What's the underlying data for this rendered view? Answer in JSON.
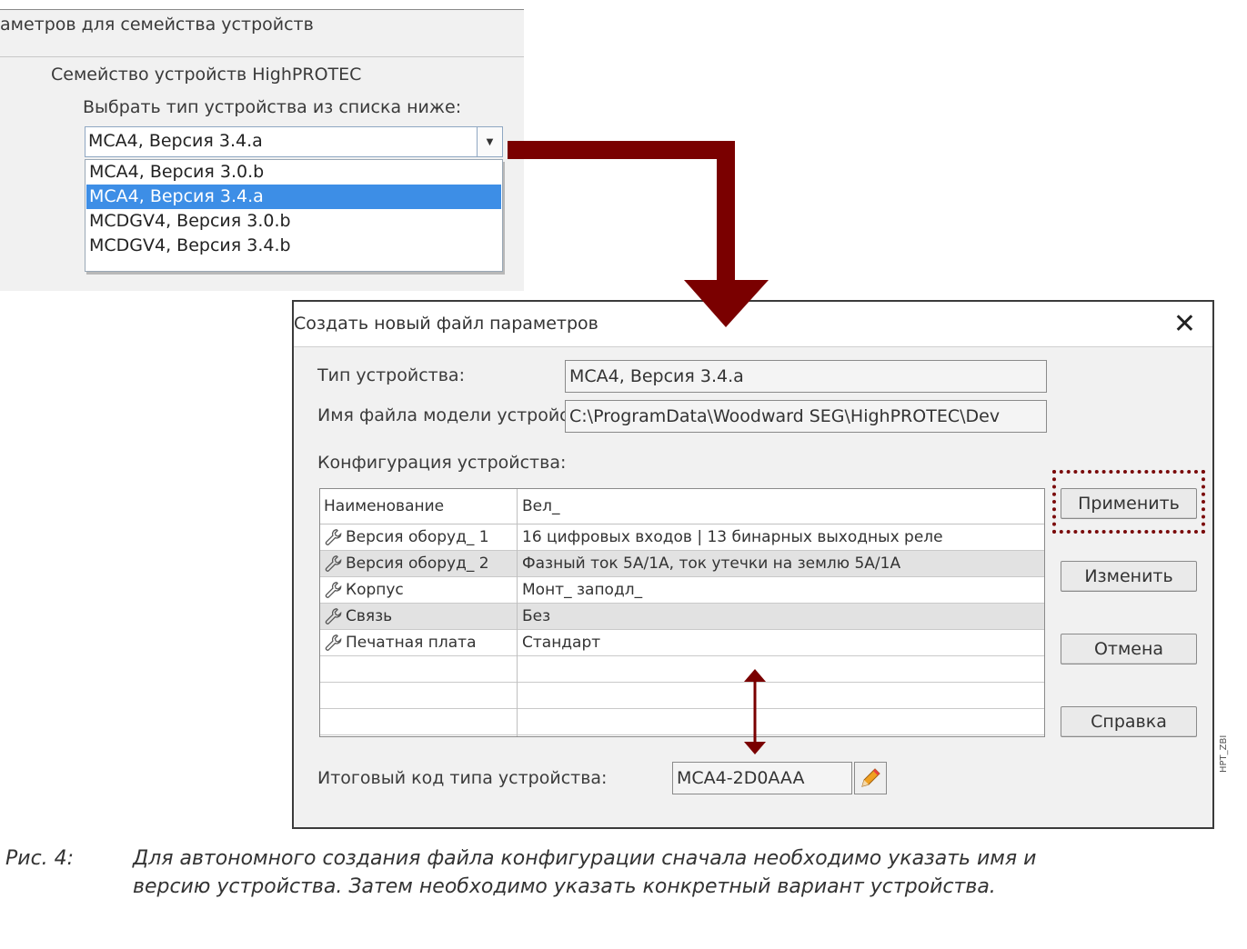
{
  "family_panel": {
    "header": "аметров для семейства устройств",
    "family_name": "Семейство устройств HighPROTEC",
    "select_prompt": "Выбрать тип устройства из списка ниже:",
    "combo_value": "MCA4, Версия 3.4.a",
    "options": [
      {
        "label": "MCA4, Версия 3.0.b",
        "selected": false
      },
      {
        "label": "MCA4, Версия 3.4.a",
        "selected": true
      },
      {
        "label": "MCDGV4, Версия 3.0.b",
        "selected": false
      },
      {
        "label": "MCDGV4, Версия 3.4.b",
        "selected": false
      }
    ]
  },
  "dialog": {
    "title": "Создать новый файл параметров",
    "close_glyph": "✕",
    "device_type_label": "Тип устройства:",
    "device_type_value": "MCA4, Версия 3.4.a",
    "model_file_label": "Имя файла модели устройства:",
    "model_file_value": "C:\\ProgramData\\Woodward SEG\\HighPROTEC\\Dev",
    "config_label": "Конфигурация устройства:",
    "table": {
      "headers": [
        "Наименование",
        "Вел_"
      ],
      "rows": [
        {
          "name": "Версия оборуд_ 1",
          "value": "16 цифровых входов | 13 бинарных выходных реле"
        },
        {
          "name": "Версия оборуд_ 2",
          "value": "Фазный ток 5А/1А, ток утечки на землю 5А/1А"
        },
        {
          "name": "Корпус",
          "value": "Монт_ заподл_"
        },
        {
          "name": "Связь",
          "value": "Без"
        },
        {
          "name": "Печатная плата",
          "value": "Стандарт"
        }
      ]
    },
    "buttons": {
      "apply": "Применить",
      "change": "Изменить",
      "cancel": "Отмена",
      "help": "Справка"
    },
    "type_code_label": "Итоговый код типа устройства:",
    "type_code_value": "MCA4-2D0AAA"
  },
  "side_label": "HPT_ZBI",
  "caption": {
    "number": "Рис. 4:",
    "line1": "Для автономного создания файла конфигурации сначала необходимо указать имя и",
    "line2": "версию устройства. Затем необходимо указать конкретный вариант устройства."
  },
  "colors": {
    "arrow": "#7a0000",
    "selection": "#3d8ee6",
    "highlight_border": "#7a0b0b"
  },
  "icons": [
    "chevron-down-icon",
    "close-icon",
    "wrench-icon",
    "pencil-icon",
    "double-arrow-icon"
  ]
}
